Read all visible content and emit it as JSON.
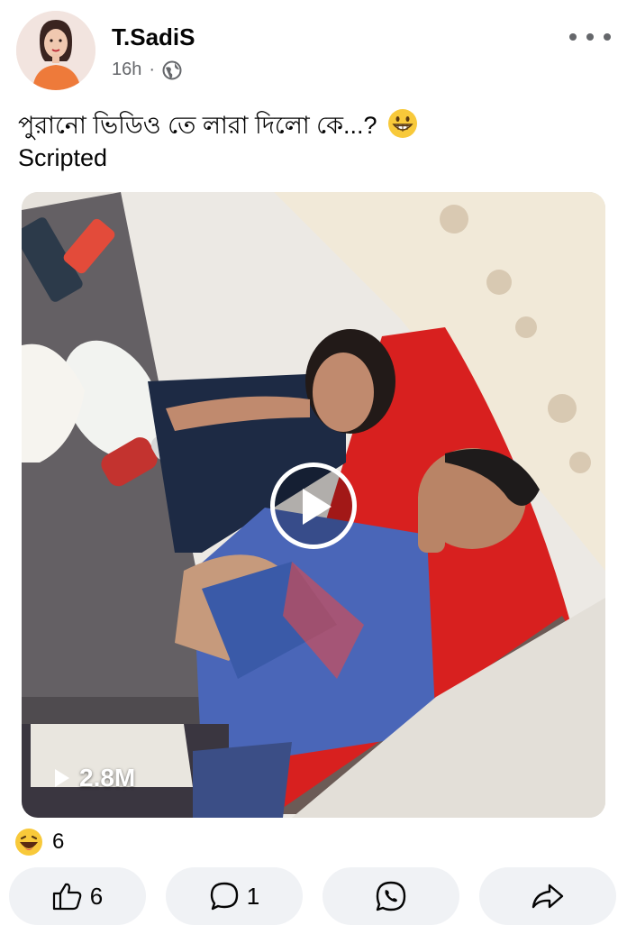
{
  "post": {
    "author": "T.SadiS",
    "time": "16h",
    "separator": "·",
    "privacy_icon": "globe-icon",
    "caption_line1": "পুরানো ভিডিও তে লারা দিলো কে...?",
    "caption_line2": "Scripted",
    "caption_emoji": "grinning-face-emoji"
  },
  "video": {
    "views": "2.8M",
    "play_icon": "play-icon"
  },
  "reactions": {
    "emoji": "laughing-face-emoji",
    "count": "6"
  },
  "actions": {
    "like_count": "6",
    "comment_count": "1",
    "whatsapp_icon": "whatsapp-icon",
    "share_icon": "share-icon"
  },
  "colors": {
    "secondary_text": "#65676b",
    "pill_bg": "#f0f2f5",
    "sofa_red": "#d8201f",
    "shirt_blue": "#4a66b8"
  }
}
